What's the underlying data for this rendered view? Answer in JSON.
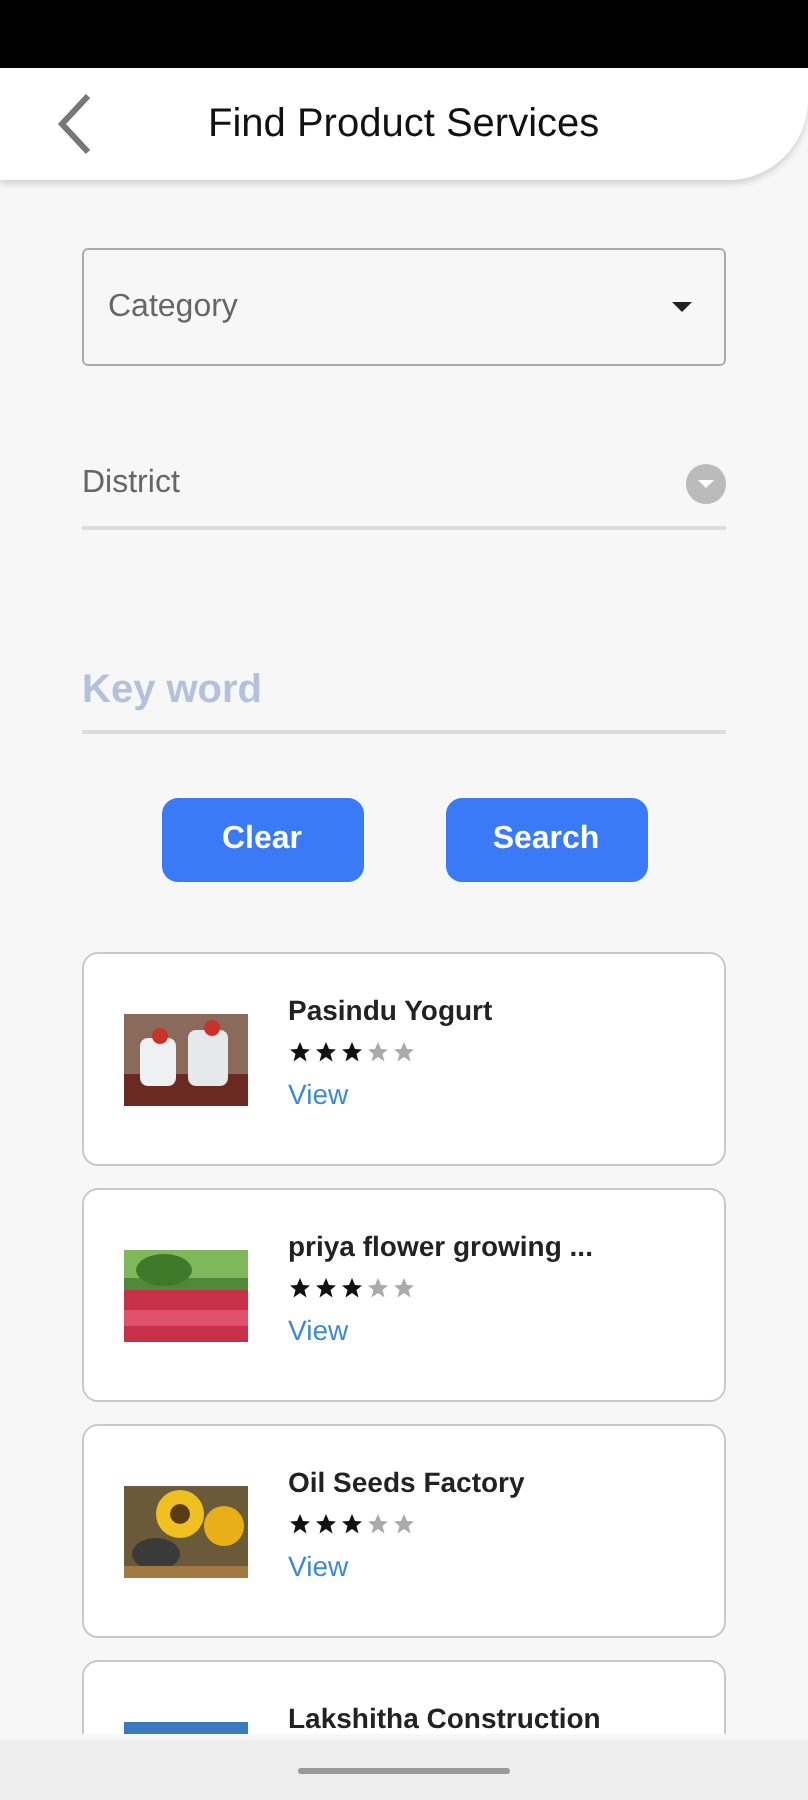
{
  "header": {
    "title": "Find Product Services"
  },
  "filters": {
    "category": {
      "placeholder": "Category"
    },
    "district": {
      "placeholder": "District"
    },
    "keyword": {
      "placeholder": "Key word"
    }
  },
  "buttons": [
    "Clear",
    "Search"
  ],
  "results": [
    {
      "name": "Pasindu Yogurt",
      "stars": 3,
      "link": "View"
    },
    {
      "name": "priya flower growing ...",
      "stars": 3,
      "link": "View"
    },
    {
      "name": "Oil Seeds Factory",
      "stars": 3,
      "link": "View"
    },
    {
      "name": "Lakshitha Construction"
    }
  ]
}
